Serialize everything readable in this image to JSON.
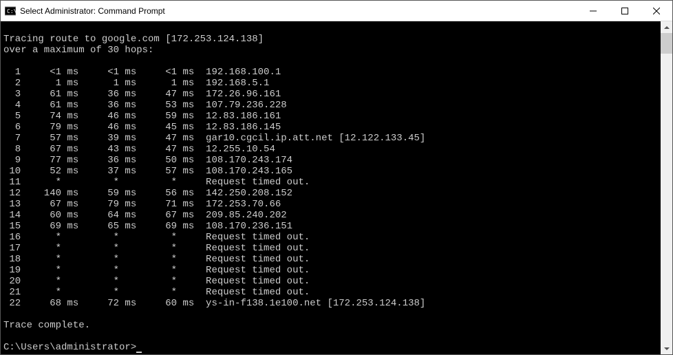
{
  "window": {
    "title": "Select Administrator: Command Prompt"
  },
  "terminal": {
    "trace_header1": "Tracing route to google.com [172.253.124.138]",
    "trace_header2": "over a maximum of 30 hops:",
    "trace_complete": "Trace complete.",
    "prompt": "C:\\Users\\administrator>",
    "hops": [
      {
        "n": 1,
        "t1": "<1 ms",
        "t2": "<1 ms",
        "t3": "<1 ms",
        "host": "192.168.100.1"
      },
      {
        "n": 2,
        "t1": "1 ms",
        "t2": "1 ms",
        "t3": "1 ms",
        "host": "192.168.5.1"
      },
      {
        "n": 3,
        "t1": "61 ms",
        "t2": "36 ms",
        "t3": "47 ms",
        "host": "172.26.96.161"
      },
      {
        "n": 4,
        "t1": "61 ms",
        "t2": "36 ms",
        "t3": "53 ms",
        "host": "107.79.236.228"
      },
      {
        "n": 5,
        "t1": "74 ms",
        "t2": "46 ms",
        "t3": "59 ms",
        "host": "12.83.186.161"
      },
      {
        "n": 6,
        "t1": "79 ms",
        "t2": "46 ms",
        "t3": "45 ms",
        "host": "12.83.186.145"
      },
      {
        "n": 7,
        "t1": "57 ms",
        "t2": "39 ms",
        "t3": "47 ms",
        "host": "gar10.cgcil.ip.att.net [12.122.133.45]"
      },
      {
        "n": 8,
        "t1": "67 ms",
        "t2": "43 ms",
        "t3": "47 ms",
        "host": "12.255.10.54"
      },
      {
        "n": 9,
        "t1": "77 ms",
        "t2": "36 ms",
        "t3": "50 ms",
        "host": "108.170.243.174"
      },
      {
        "n": 10,
        "t1": "52 ms",
        "t2": "37 ms",
        "t3": "57 ms",
        "host": "108.170.243.165"
      },
      {
        "n": 11,
        "t1": "*",
        "t2": "*",
        "t3": "*",
        "host": "Request timed out."
      },
      {
        "n": 12,
        "t1": "140 ms",
        "t2": "59 ms",
        "t3": "56 ms",
        "host": "142.250.208.152"
      },
      {
        "n": 13,
        "t1": "67 ms",
        "t2": "79 ms",
        "t3": "71 ms",
        "host": "172.253.70.66"
      },
      {
        "n": 14,
        "t1": "60 ms",
        "t2": "64 ms",
        "t3": "67 ms",
        "host": "209.85.240.202"
      },
      {
        "n": 15,
        "t1": "69 ms",
        "t2": "65 ms",
        "t3": "69 ms",
        "host": "108.170.236.151"
      },
      {
        "n": 16,
        "t1": "*",
        "t2": "*",
        "t3": "*",
        "host": "Request timed out."
      },
      {
        "n": 17,
        "t1": "*",
        "t2": "*",
        "t3": "*",
        "host": "Request timed out."
      },
      {
        "n": 18,
        "t1": "*",
        "t2": "*",
        "t3": "*",
        "host": "Request timed out."
      },
      {
        "n": 19,
        "t1": "*",
        "t2": "*",
        "t3": "*",
        "host": "Request timed out."
      },
      {
        "n": 20,
        "t1": "*",
        "t2": "*",
        "t3": "*",
        "host": "Request timed out."
      },
      {
        "n": 21,
        "t1": "*",
        "t2": "*",
        "t3": "*",
        "host": "Request timed out."
      },
      {
        "n": 22,
        "t1": "68 ms",
        "t2": "72 ms",
        "t3": "60 ms",
        "host": "ys-in-f138.1e100.net [172.253.124.138]"
      }
    ]
  }
}
